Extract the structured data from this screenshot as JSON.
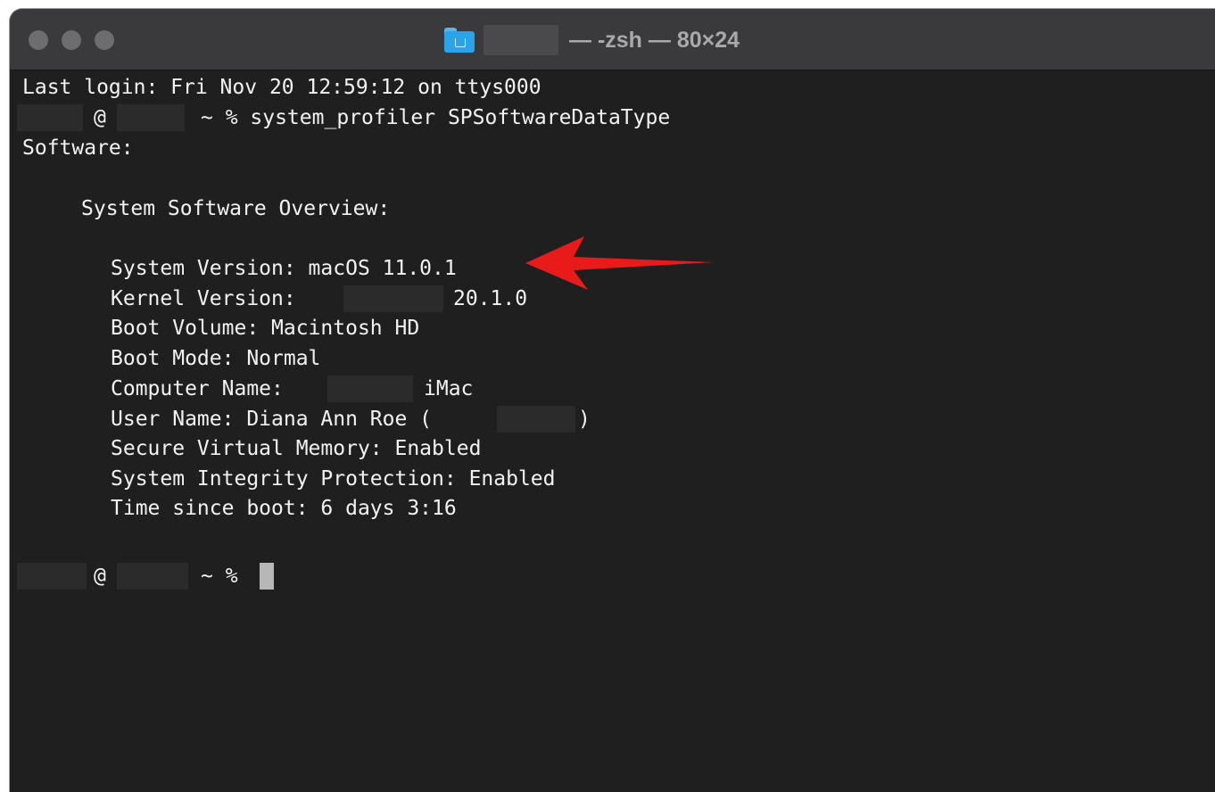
{
  "window": {
    "title": "— -zsh — 80×24",
    "folder_icon": "folder-icon"
  },
  "terminal": {
    "last_login": "Last login: Fri Nov 20 12:59:12 on ttys000",
    "prompt_at": "@",
    "command_prompt": "~ % system_profiler SPSoftwareDataType",
    "software_header": "Software:",
    "overview_header": "System Software Overview:",
    "system_version": "System Version: macOS 11.0.1",
    "kernel_label": "Kernel Version:",
    "kernel_value": "20.1.0",
    "boot_volume": "Boot Volume: Macintosh HD",
    "boot_mode": "Boot Mode: Normal",
    "computer_name_label": "Computer Name:",
    "computer_name_value": "iMac",
    "user_name_label": "User Name: Diana Ann Roe (",
    "user_name_close": ")",
    "secure_memory": "Secure Virtual Memory: Enabled",
    "sip": "System Integrity Protection: Enabled",
    "time_since_boot": "Time since boot: 6 days 3:16",
    "final_prompt": "~ %"
  },
  "annotation": {
    "arrow_color": "#e81a1a"
  }
}
